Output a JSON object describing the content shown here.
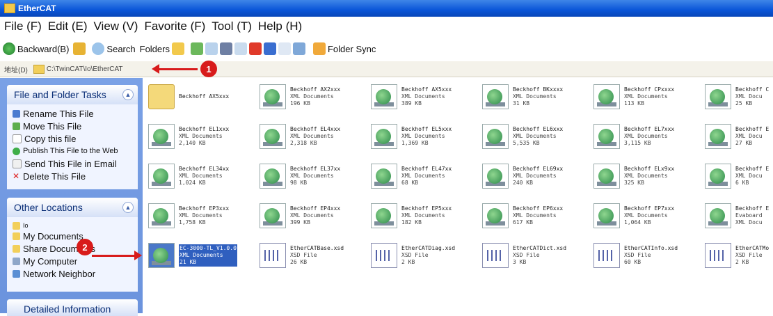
{
  "window": {
    "title": "EtherCAT"
  },
  "menu": [
    "File (F)",
    "Edit (E)",
    "View (V)",
    "Favorite (F)",
    "Tool (T)",
    "Help (H)"
  ],
  "toolbar": {
    "back_label": "Backward(B)",
    "search_label": "Search",
    "folders_label": "Folders",
    "sync_label": "Folder Sync"
  },
  "address": {
    "label": "地址(D)",
    "path": "C:\\TwinCAT\\Io\\EtherCAT"
  },
  "sidebar": {
    "tasks_title": "File and Folder Tasks",
    "tasks": [
      "Rename This File",
      "Move This File",
      "Copy this file",
      "Publish This File to the Web",
      "Send This File in Email",
      "Delete This File"
    ],
    "other_title": "Other Locations",
    "other": [
      "Io",
      "My Documents",
      "Share Documents",
      "My Computer",
      "Network Neighbor"
    ],
    "detail_title": "Detailed Information"
  },
  "files": [
    {
      "name": "Beckhoff AX5xxx",
      "type": "",
      "size": "",
      "icon": "folder"
    },
    {
      "name": "Beckhoff AX2xxx",
      "type": "XML Documents",
      "size": "196 KB",
      "icon": "xml"
    },
    {
      "name": "Beckhoff AX5xxx",
      "type": "XML Documents",
      "size": "389 KB",
      "icon": "xml"
    },
    {
      "name": "Beckhoff BKxxxx",
      "type": "XML Documents",
      "size": "31 KB",
      "icon": "xml"
    },
    {
      "name": "Beckhoff CPxxxx",
      "type": "XML Documents",
      "size": "113 KB",
      "icon": "xml"
    },
    {
      "name": "Beckhoff C",
      "type": "XML Docu",
      "size": "25 KB",
      "icon": "xml"
    },
    {
      "name": "Beckhoff EL1xxx",
      "type": "XML Documents",
      "size": "2,140 KB",
      "icon": "xml"
    },
    {
      "name": "Beckhoff EL4xxx",
      "type": "XML Documents",
      "size": "2,318 KB",
      "icon": "xml"
    },
    {
      "name": "Beckhoff EL5xxx",
      "type": "XML Documents",
      "size": "1,369 KB",
      "icon": "xml"
    },
    {
      "name": "Beckhoff EL6xxx",
      "type": "XML Documents",
      "size": "5,535 KB",
      "icon": "xml"
    },
    {
      "name": "Beckhoff EL7xxx",
      "type": "XML Documents",
      "size": "3,115 KB",
      "icon": "xml"
    },
    {
      "name": "Beckhoff E",
      "type": "XML Docu",
      "size": "27 KB",
      "icon": "xml"
    },
    {
      "name": "Beckhoff EL34xx",
      "type": "XML Documents",
      "size": "1,024 KB",
      "icon": "xml"
    },
    {
      "name": "Beckhoff EL37xx",
      "type": "XML Documents",
      "size": "98 KB",
      "icon": "xml"
    },
    {
      "name": "Beckhoff EL47xx",
      "type": "XML Documents",
      "size": "68 KB",
      "icon": "xml"
    },
    {
      "name": "Beckhoff EL69xx",
      "type": "XML Documents",
      "size": "240 KB",
      "icon": "xml"
    },
    {
      "name": "Beckhoff ELx9xx",
      "type": "XML Documents",
      "size": "325 KB",
      "icon": "xml"
    },
    {
      "name": "Beckhoff E",
      "type": "XML Docu",
      "size": "6 KB",
      "icon": "xml"
    },
    {
      "name": "Beckhoff EP3xxx",
      "type": "XML Documents",
      "size": "1,758 KB",
      "icon": "xml"
    },
    {
      "name": "Beckhoff EP4xxx",
      "type": "XML Documents",
      "size": "399 KB",
      "icon": "xml"
    },
    {
      "name": "Beckhoff EP5xxx",
      "type": "XML Documents",
      "size": "182 KB",
      "icon": "xml"
    },
    {
      "name": "Beckhoff EP6xxx",
      "type": "XML Documents",
      "size": "617 KB",
      "icon": "xml"
    },
    {
      "name": "Beckhoff EP7xxx",
      "type": "XML Documents",
      "size": "1,064 KB",
      "icon": "xml"
    },
    {
      "name": "Beckhoff E",
      "type": "Evaboard",
      "size": "XML Docu",
      "icon": "xml"
    },
    {
      "name": "EC-3000-TL_V1.0.0",
      "type": "XML Documents",
      "size": "21 KB",
      "icon": "xml",
      "selected": true
    },
    {
      "name": "EtherCATBase.xsd",
      "type": "XSD File",
      "size": "26 KB",
      "icon": "xsd"
    },
    {
      "name": "EtherCATDiag.xsd",
      "type": "XSD File",
      "size": "2 KB",
      "icon": "xsd"
    },
    {
      "name": "EtherCATDict.xsd",
      "type": "XSD File",
      "size": "3 KB",
      "icon": "xsd"
    },
    {
      "name": "EtherCATInfo.xsd",
      "type": "XSD File",
      "size": "60 KB",
      "icon": "xsd"
    },
    {
      "name": "EtherCATMo",
      "type": "XSD File",
      "size": "2 KB",
      "icon": "xsd"
    }
  ],
  "callouts": [
    "1",
    "2"
  ],
  "colors": {
    "accent": "#d81b1b",
    "sidebar": "#7aa1e6",
    "titlebar": "#0a55d8"
  }
}
